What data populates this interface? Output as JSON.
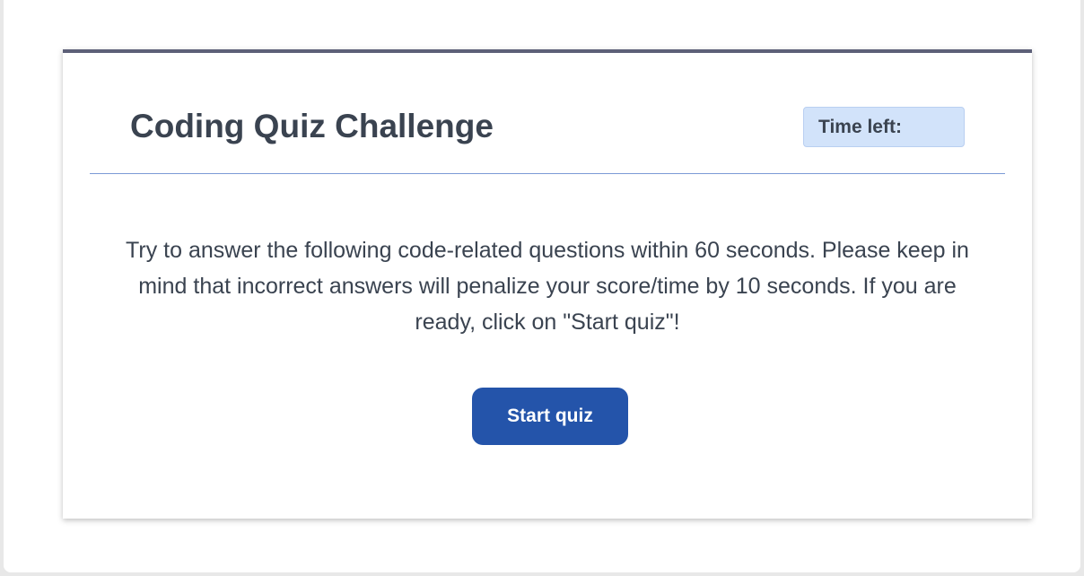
{
  "header": {
    "title": "Coding Quiz Challenge",
    "timer_label": "Time left:",
    "timer_value": ""
  },
  "main": {
    "intro_text": "Try to answer the following code-related questions within 60 seconds. Please keep in mind that incorrect answers will penalize your score/time by 10 seconds. If you are ready, click on \"Start quiz\"!",
    "start_button_label": "Start quiz"
  },
  "colors": {
    "card_top_border": "#5d6078",
    "header_divider": "#7b9ad6",
    "timer_background": "#d2e3fa",
    "button_background": "#2454aa",
    "text": "#3a4350"
  }
}
